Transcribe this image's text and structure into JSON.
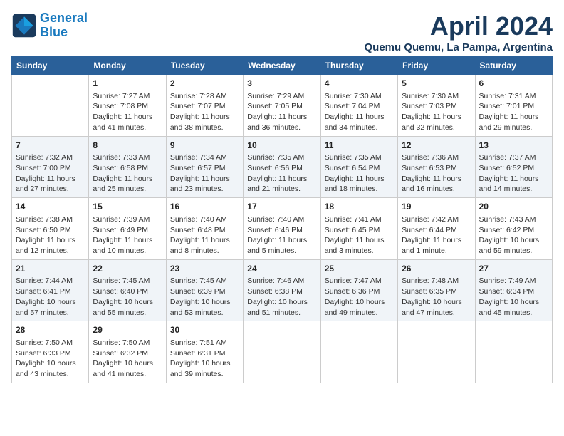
{
  "header": {
    "logo_general": "General",
    "logo_blue": "Blue",
    "title": "April 2024",
    "location": "Quemu Quemu, La Pampa, Argentina"
  },
  "columns": [
    "Sunday",
    "Monday",
    "Tuesday",
    "Wednesday",
    "Thursday",
    "Friday",
    "Saturday"
  ],
  "weeks": [
    [
      {
        "day": "",
        "info": ""
      },
      {
        "day": "1",
        "info": "Sunrise: 7:27 AM\nSunset: 7:08 PM\nDaylight: 11 hours\nand 41 minutes."
      },
      {
        "day": "2",
        "info": "Sunrise: 7:28 AM\nSunset: 7:07 PM\nDaylight: 11 hours\nand 38 minutes."
      },
      {
        "day": "3",
        "info": "Sunrise: 7:29 AM\nSunset: 7:05 PM\nDaylight: 11 hours\nand 36 minutes."
      },
      {
        "day": "4",
        "info": "Sunrise: 7:30 AM\nSunset: 7:04 PM\nDaylight: 11 hours\nand 34 minutes."
      },
      {
        "day": "5",
        "info": "Sunrise: 7:30 AM\nSunset: 7:03 PM\nDaylight: 11 hours\nand 32 minutes."
      },
      {
        "day": "6",
        "info": "Sunrise: 7:31 AM\nSunset: 7:01 PM\nDaylight: 11 hours\nand 29 minutes."
      }
    ],
    [
      {
        "day": "7",
        "info": "Sunrise: 7:32 AM\nSunset: 7:00 PM\nDaylight: 11 hours\nand 27 minutes."
      },
      {
        "day": "8",
        "info": "Sunrise: 7:33 AM\nSunset: 6:58 PM\nDaylight: 11 hours\nand 25 minutes."
      },
      {
        "day": "9",
        "info": "Sunrise: 7:34 AM\nSunset: 6:57 PM\nDaylight: 11 hours\nand 23 minutes."
      },
      {
        "day": "10",
        "info": "Sunrise: 7:35 AM\nSunset: 6:56 PM\nDaylight: 11 hours\nand 21 minutes."
      },
      {
        "day": "11",
        "info": "Sunrise: 7:35 AM\nSunset: 6:54 PM\nDaylight: 11 hours\nand 18 minutes."
      },
      {
        "day": "12",
        "info": "Sunrise: 7:36 AM\nSunset: 6:53 PM\nDaylight: 11 hours\nand 16 minutes."
      },
      {
        "day": "13",
        "info": "Sunrise: 7:37 AM\nSunset: 6:52 PM\nDaylight: 11 hours\nand 14 minutes."
      }
    ],
    [
      {
        "day": "14",
        "info": "Sunrise: 7:38 AM\nSunset: 6:50 PM\nDaylight: 11 hours\nand 12 minutes."
      },
      {
        "day": "15",
        "info": "Sunrise: 7:39 AM\nSunset: 6:49 PM\nDaylight: 11 hours\nand 10 minutes."
      },
      {
        "day": "16",
        "info": "Sunrise: 7:40 AM\nSunset: 6:48 PM\nDaylight: 11 hours\nand 8 minutes."
      },
      {
        "day": "17",
        "info": "Sunrise: 7:40 AM\nSunset: 6:46 PM\nDaylight: 11 hours\nand 5 minutes."
      },
      {
        "day": "18",
        "info": "Sunrise: 7:41 AM\nSunset: 6:45 PM\nDaylight: 11 hours\nand 3 minutes."
      },
      {
        "day": "19",
        "info": "Sunrise: 7:42 AM\nSunset: 6:44 PM\nDaylight: 11 hours\nand 1 minute."
      },
      {
        "day": "20",
        "info": "Sunrise: 7:43 AM\nSunset: 6:42 PM\nDaylight: 10 hours\nand 59 minutes."
      }
    ],
    [
      {
        "day": "21",
        "info": "Sunrise: 7:44 AM\nSunset: 6:41 PM\nDaylight: 10 hours\nand 57 minutes."
      },
      {
        "day": "22",
        "info": "Sunrise: 7:45 AM\nSunset: 6:40 PM\nDaylight: 10 hours\nand 55 minutes."
      },
      {
        "day": "23",
        "info": "Sunrise: 7:45 AM\nSunset: 6:39 PM\nDaylight: 10 hours\nand 53 minutes."
      },
      {
        "day": "24",
        "info": "Sunrise: 7:46 AM\nSunset: 6:38 PM\nDaylight: 10 hours\nand 51 minutes."
      },
      {
        "day": "25",
        "info": "Sunrise: 7:47 AM\nSunset: 6:36 PM\nDaylight: 10 hours\nand 49 minutes."
      },
      {
        "day": "26",
        "info": "Sunrise: 7:48 AM\nSunset: 6:35 PM\nDaylight: 10 hours\nand 47 minutes."
      },
      {
        "day": "27",
        "info": "Sunrise: 7:49 AM\nSunset: 6:34 PM\nDaylight: 10 hours\nand 45 minutes."
      }
    ],
    [
      {
        "day": "28",
        "info": "Sunrise: 7:50 AM\nSunset: 6:33 PM\nDaylight: 10 hours\nand 43 minutes."
      },
      {
        "day": "29",
        "info": "Sunrise: 7:50 AM\nSunset: 6:32 PM\nDaylight: 10 hours\nand 41 minutes."
      },
      {
        "day": "30",
        "info": "Sunrise: 7:51 AM\nSunset: 6:31 PM\nDaylight: 10 hours\nand 39 minutes."
      },
      {
        "day": "",
        "info": ""
      },
      {
        "day": "",
        "info": ""
      },
      {
        "day": "",
        "info": ""
      },
      {
        "day": "",
        "info": ""
      }
    ]
  ]
}
